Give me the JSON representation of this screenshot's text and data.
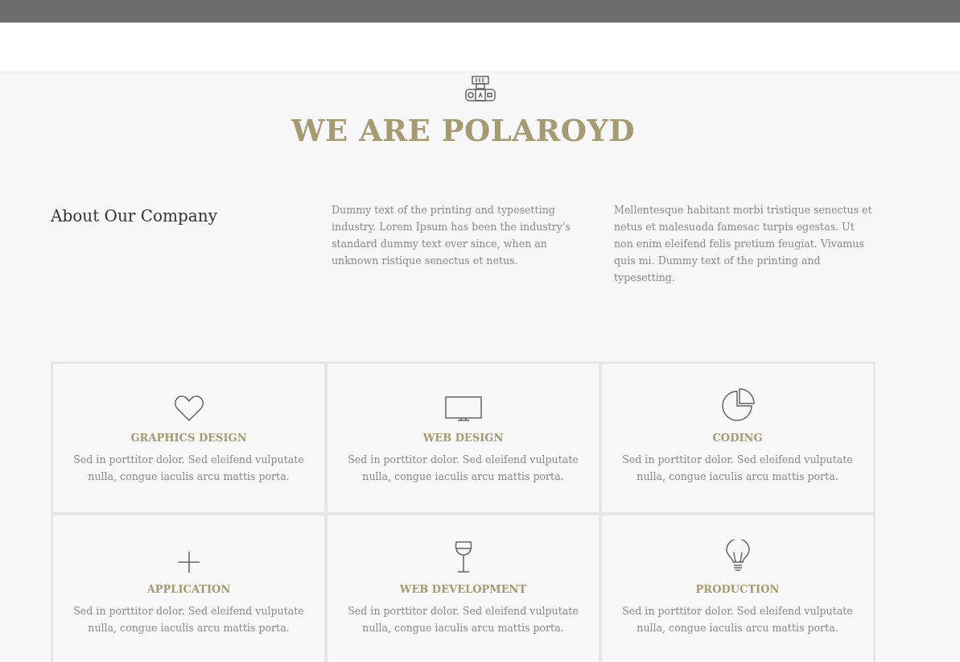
{
  "hero": {
    "title": "WE ARE POLAROYD"
  },
  "about": {
    "heading": "About Our Company",
    "paragraphs": [
      "Dummy text of the printing and typesetting industry. Lorem Ipsum has been the industry's standard dummy text ever since, when an unknown ristique senectus et netus.",
      "Mellentesque habitant morbi tristique senectus et netus et malesuada famesac turpis egestas. Ut non enim eleifend felis pretium feugiat. Vivamus quis mi. Dummy text of the printing and typesetting."
    ]
  },
  "services": [
    {
      "kind": "heart",
      "title": "GRAPHICS DESIGN",
      "text": "Sed in porttitor dolor. Sed eleifend vulputate nulla, congue iaculis arcu mattis porta."
    },
    {
      "kind": "monitor",
      "title": "WEB DESIGN",
      "text": "Sed in porttitor dolor. Sed eleifend vulputate nulla, congue iaculis arcu mattis porta."
    },
    {
      "kind": "pie",
      "title": "CODING",
      "text": "Sed in porttitor dolor. Sed eleifend vulputate nulla, congue iaculis arcu mattis porta."
    },
    {
      "kind": "plus",
      "title": "APPLICATION",
      "text": "Sed in porttitor dolor. Sed eleifend vulputate nulla, congue iaculis arcu mattis porta."
    },
    {
      "kind": "glass",
      "title": "WEB DEVELOPMENT",
      "text": "Sed in porttitor dolor. Sed eleifend vulputate nulla, congue iaculis arcu mattis porta."
    },
    {
      "kind": "bulb",
      "title": "PRODUCTION",
      "text": "Sed in porttitor dolor. Sed eleifend vulputate nulla, congue iaculis arcu mattis porta."
    }
  ]
}
